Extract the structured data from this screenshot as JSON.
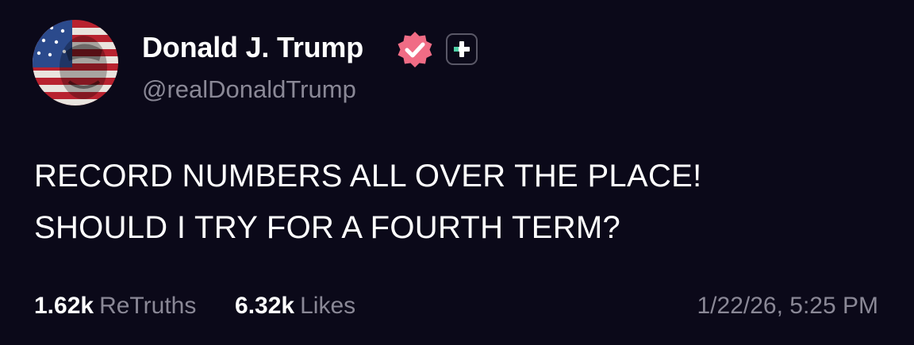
{
  "author": {
    "display_name": "Donald J. Trump",
    "handle": "@realDonaldTrump",
    "verified_icon": "verified-badge-icon",
    "plus_icon": "plus-badge-icon"
  },
  "post": {
    "lines": [
      "RECORD NUMBERS ALL OVER THE PLACE!",
      "SHOULD I TRY FOR A FOURTH TERM?"
    ]
  },
  "stats": {
    "retruths_count": "1.62k",
    "retruths_label": "ReTruths",
    "likes_count": "6.32k",
    "likes_label": "Likes"
  },
  "timestamp": "1/22/26, 5:25 PM",
  "colors": {
    "background": "#0b0919",
    "text_primary": "#ffffff",
    "text_secondary": "#8a8896",
    "verified_badge": "#f06c85",
    "plus_accent": "#4fd1a6"
  }
}
